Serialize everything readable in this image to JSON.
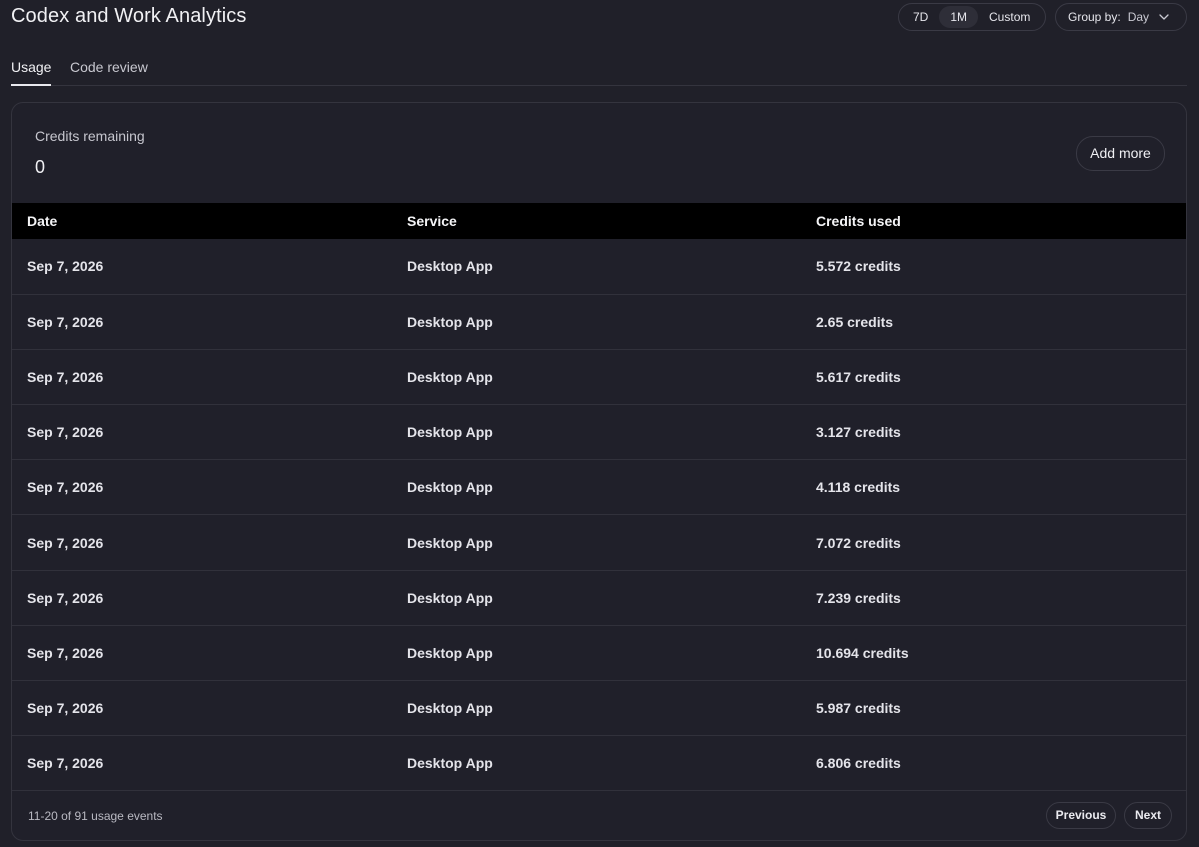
{
  "header": {
    "title": "Codex and Work Analytics",
    "ranges": [
      "7D",
      "1M",
      "Custom"
    ],
    "active_range": "1M",
    "group_by_label": "Group by:",
    "group_by_value": "Day"
  },
  "tabs": [
    {
      "label": "Usage",
      "active": true
    },
    {
      "label": "Code review",
      "active": false
    }
  ],
  "credits": {
    "label": "Credits remaining",
    "value": "0",
    "add_more_label": "Add more"
  },
  "table": {
    "columns": [
      "Date",
      "Service",
      "Credits used"
    ],
    "rows": [
      [
        "Sep 7, 2026",
        "Desktop App",
        "5.572 credits"
      ],
      [
        "Sep 7, 2026",
        "Desktop App",
        "2.65 credits"
      ],
      [
        "Sep 7, 2026",
        "Desktop App",
        "5.617 credits"
      ],
      [
        "Sep 7, 2026",
        "Desktop App",
        "3.127 credits"
      ],
      [
        "Sep 7, 2026",
        "Desktop App",
        "4.118 credits"
      ],
      [
        "Sep 7, 2026",
        "Desktop App",
        "7.072 credits"
      ],
      [
        "Sep 7, 2026",
        "Desktop App",
        "7.239 credits"
      ],
      [
        "Sep 7, 2026",
        "Desktop App",
        "10.694 credits"
      ],
      [
        "Sep 7, 2026",
        "Desktop App",
        "5.987 credits"
      ],
      [
        "Sep 7, 2026",
        "Desktop App",
        "6.806 credits"
      ]
    ]
  },
  "footer": {
    "count_text": "11-20 of 91 usage events",
    "previous_label": "Previous",
    "next_label": "Next"
  },
  "icons": {
    "group_by_chevron": "chevron-down-icon"
  },
  "colors": {
    "background": "#202029",
    "table_header": "#000000",
    "border": "#34343e"
  }
}
